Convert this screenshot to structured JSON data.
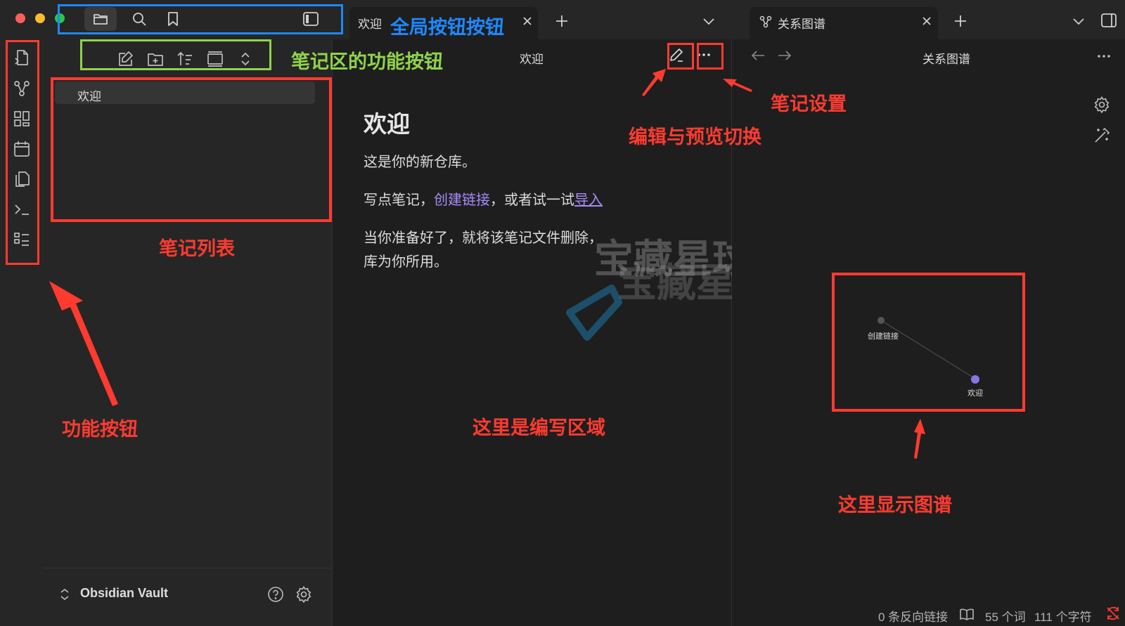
{
  "tabs": {
    "main_tab_label": "欢迎",
    "graph_tab_label": "关系图谱"
  },
  "explorer": {
    "files": [
      {
        "name": "欢迎"
      }
    ],
    "vault_name": "Obsidian Vault"
  },
  "editor": {
    "header_title": "欢迎",
    "note_title": "欢迎",
    "line1": "这是你的新仓库。",
    "line2_prefix": "写点笔记，",
    "line2_link1": "创建链接",
    "line2_middle": "，或者试一试",
    "line2_link2": "导入",
    "line3_a": "当你准备好了，就将该笔记文件删除，",
    "line3_b": "库为你所用。"
  },
  "graph": {
    "header_title": "关系图谱",
    "nodes": [
      {
        "label": "创建链接"
      },
      {
        "label": "欢迎"
      }
    ],
    "accent_color": "#8b73e8"
  },
  "status": {
    "backlinks": "0 条反向链接",
    "words": "55 个词",
    "chars": "111 个字符"
  },
  "watermark": "宝藏星球屋",
  "annotations": {
    "global_buttons": "全局按钮按钮",
    "note_area_buttons": "笔记区的功能按钮",
    "edit_preview_toggle": "编辑与预览切换",
    "note_settings": "笔记设置",
    "note_list": "笔记列表",
    "function_buttons": "功能按钮",
    "writing_area": "这里是编写区域",
    "graph_display": "这里显示图谱",
    "colors": {
      "red": "#ff3b30",
      "blue": "#1e88ff",
      "green": "#8fd44a"
    }
  }
}
